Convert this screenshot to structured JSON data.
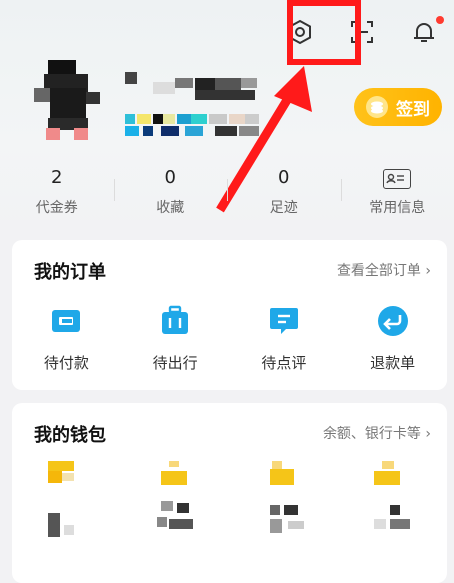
{
  "header": {
    "checkin_label": "签到"
  },
  "stats": [
    {
      "value": "2",
      "label": "代金券"
    },
    {
      "value": "0",
      "label": "收藏"
    },
    {
      "value": "0",
      "label": "足迹"
    },
    {
      "value": "",
      "label": "常用信息"
    }
  ],
  "orders": {
    "title": "我的订单",
    "link": "查看全部订单 ›",
    "items": [
      {
        "label": "待付款"
      },
      {
        "label": "待出行"
      },
      {
        "label": "待点评"
      },
      {
        "label": "退款单"
      }
    ]
  },
  "wallet": {
    "title": "我的钱包",
    "link": "余额、银行卡等 ›"
  },
  "colors": {
    "accent": "#1fa8e8",
    "checkin": "#ffb300",
    "highlight": "#ff1a1a"
  }
}
